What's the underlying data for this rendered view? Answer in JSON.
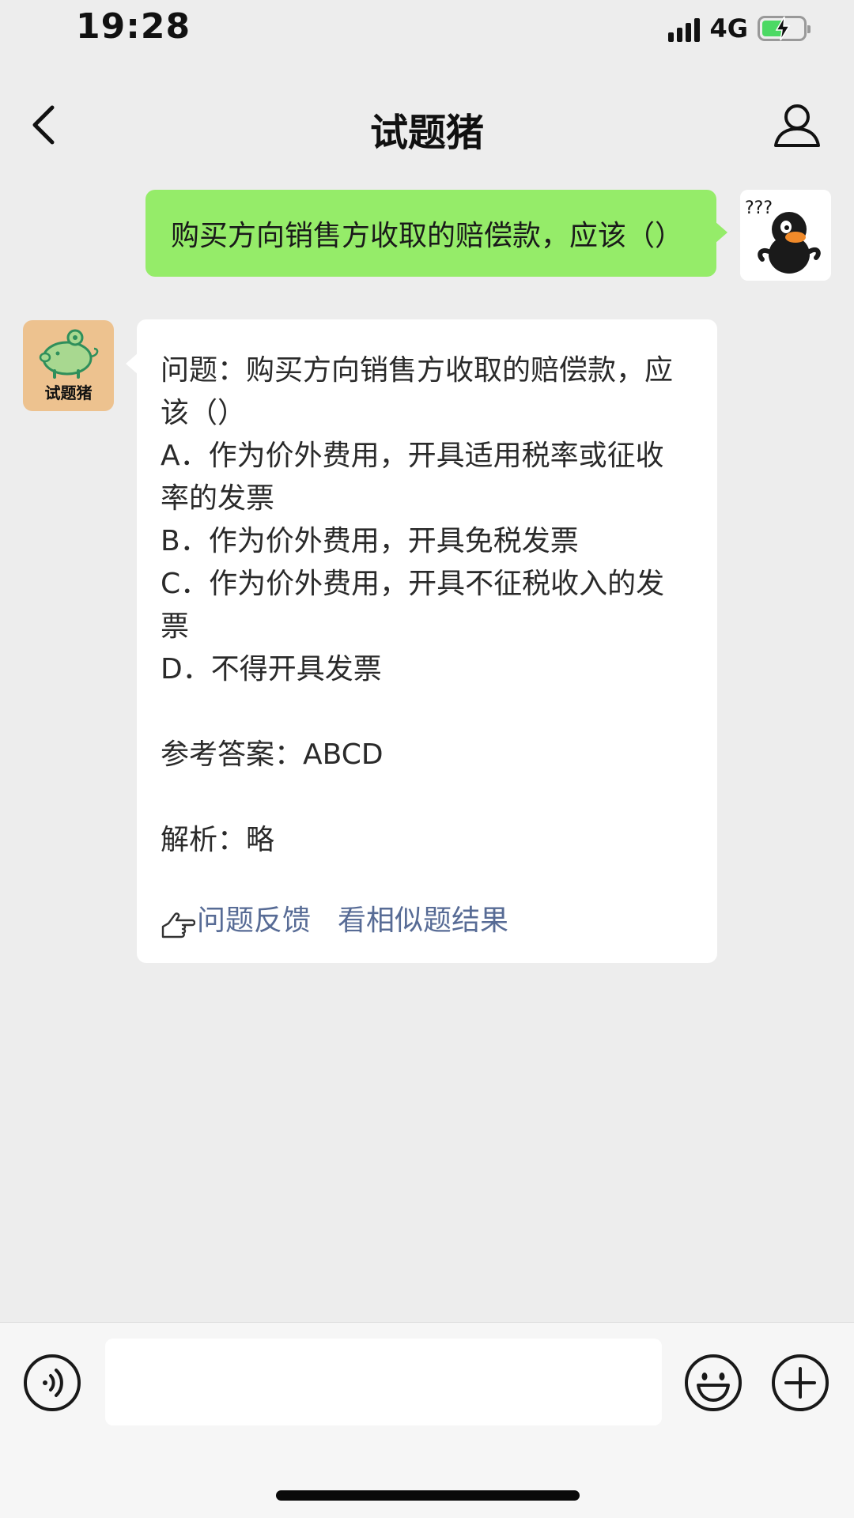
{
  "status_bar": {
    "time": "19:28",
    "network": "4G",
    "battery_level": 0.55,
    "charging": true
  },
  "nav": {
    "title": "试题猪",
    "back_icon": "chevron-left-icon",
    "profile_icon": "person-icon"
  },
  "messages": {
    "outgoing": {
      "text": "购买方向销售方收取的赔偿款，应该（）"
    },
    "incoming": {
      "avatar_label": "试题猪",
      "lines": [
        "问题：购买方向销售方收取的赔偿款，应",
        "该（）",
        "A．作为价外费用，开具适用税率或征收",
        "率的发票",
        "B．作为价外费用，开具免税发票",
        "C．作为价外费用，开具不征税收入的发",
        "票",
        "D．不得开具发票"
      ],
      "answer": "参考答案：ABCD",
      "analysis": "解析：略",
      "feedback_link": "问题反馈",
      "similar_link": "看相似题结果"
    }
  },
  "input_bar": {
    "value": "",
    "placeholder": "",
    "icons": [
      "voice-icon",
      "emoji-icon",
      "plus-icon"
    ]
  },
  "colors": {
    "background": "#ededed",
    "outgoing_bubble": "#95ec69",
    "link": "#576b95",
    "bot_avatar_bg": "#edc28f"
  }
}
